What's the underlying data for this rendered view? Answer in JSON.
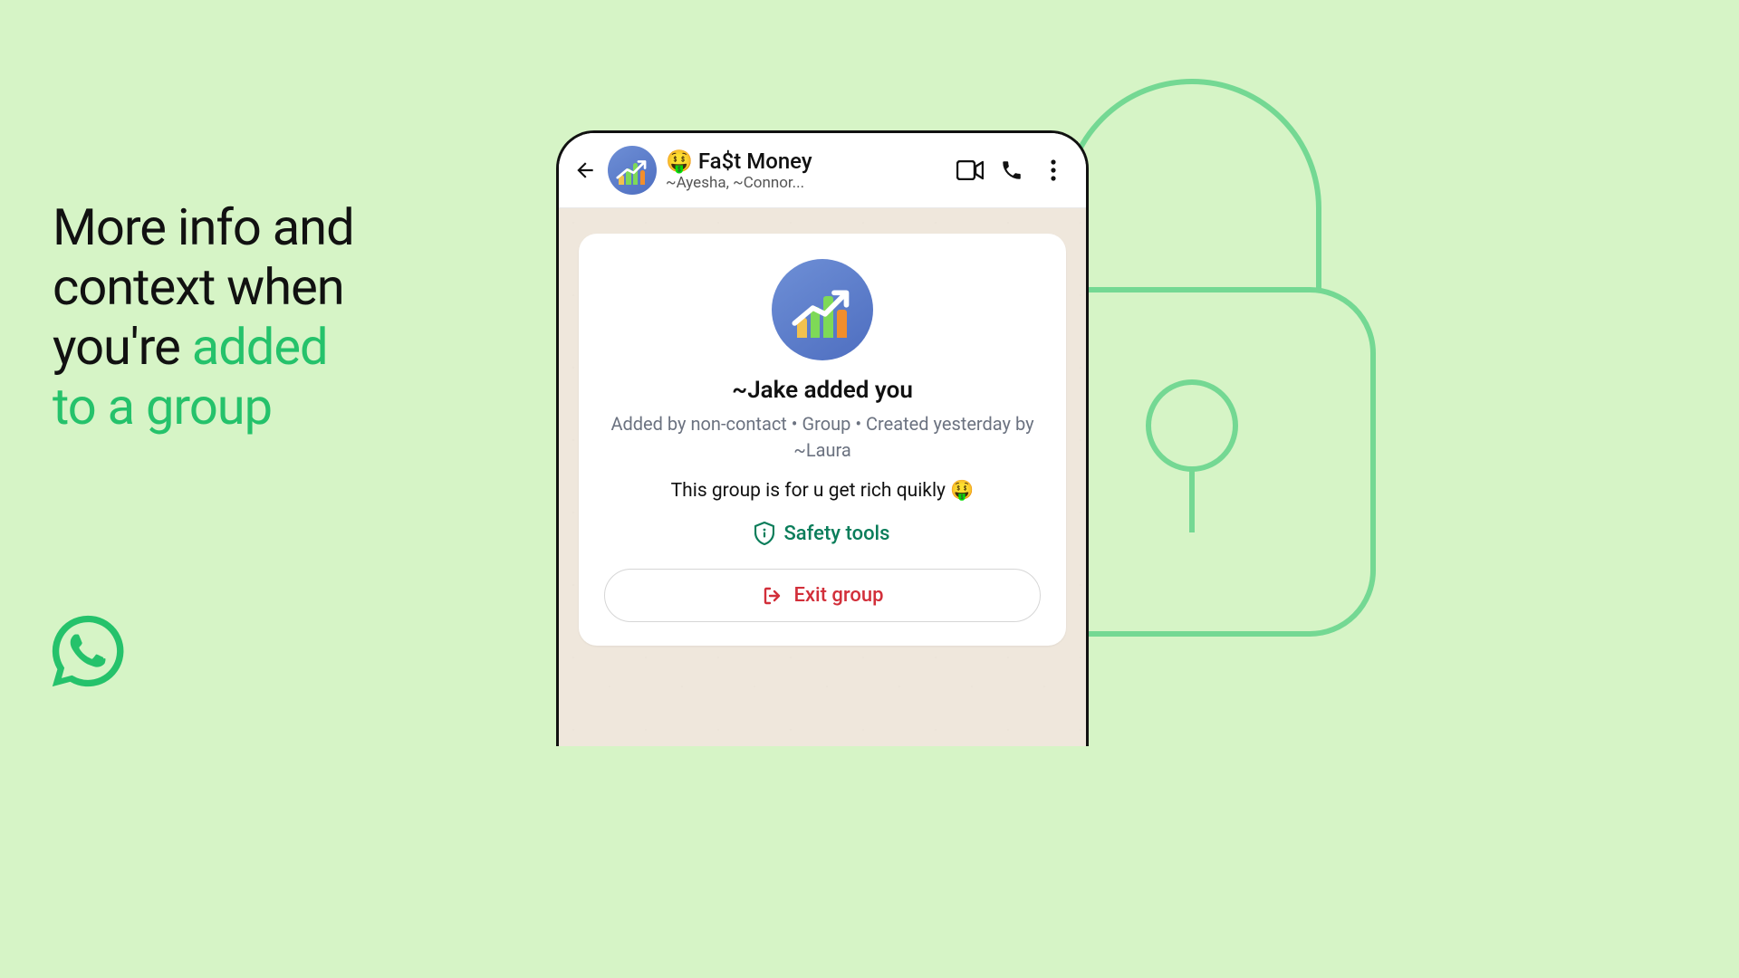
{
  "headline": {
    "line1": "More info and",
    "line2": "context when",
    "line3_plain": "you're ",
    "line3_accent": "added",
    "line4_accent": "to a group"
  },
  "header": {
    "title_emoji": "🤑",
    "title_text": "Fa$t Money",
    "subtitle": "~Ayesha, ~Connor..."
  },
  "card": {
    "added_title": "~Jake added you",
    "meta_line": "Added by non-contact • Group • Created yesterday by ~Laura",
    "description": "This group is for u get rich quikly 🤑",
    "safety_label": "Safety tools",
    "exit_label": "Exit group"
  },
  "colors": {
    "accent_green": "#25c26b",
    "safety_green": "#0a7d5a",
    "exit_red": "#d22f3a"
  }
}
